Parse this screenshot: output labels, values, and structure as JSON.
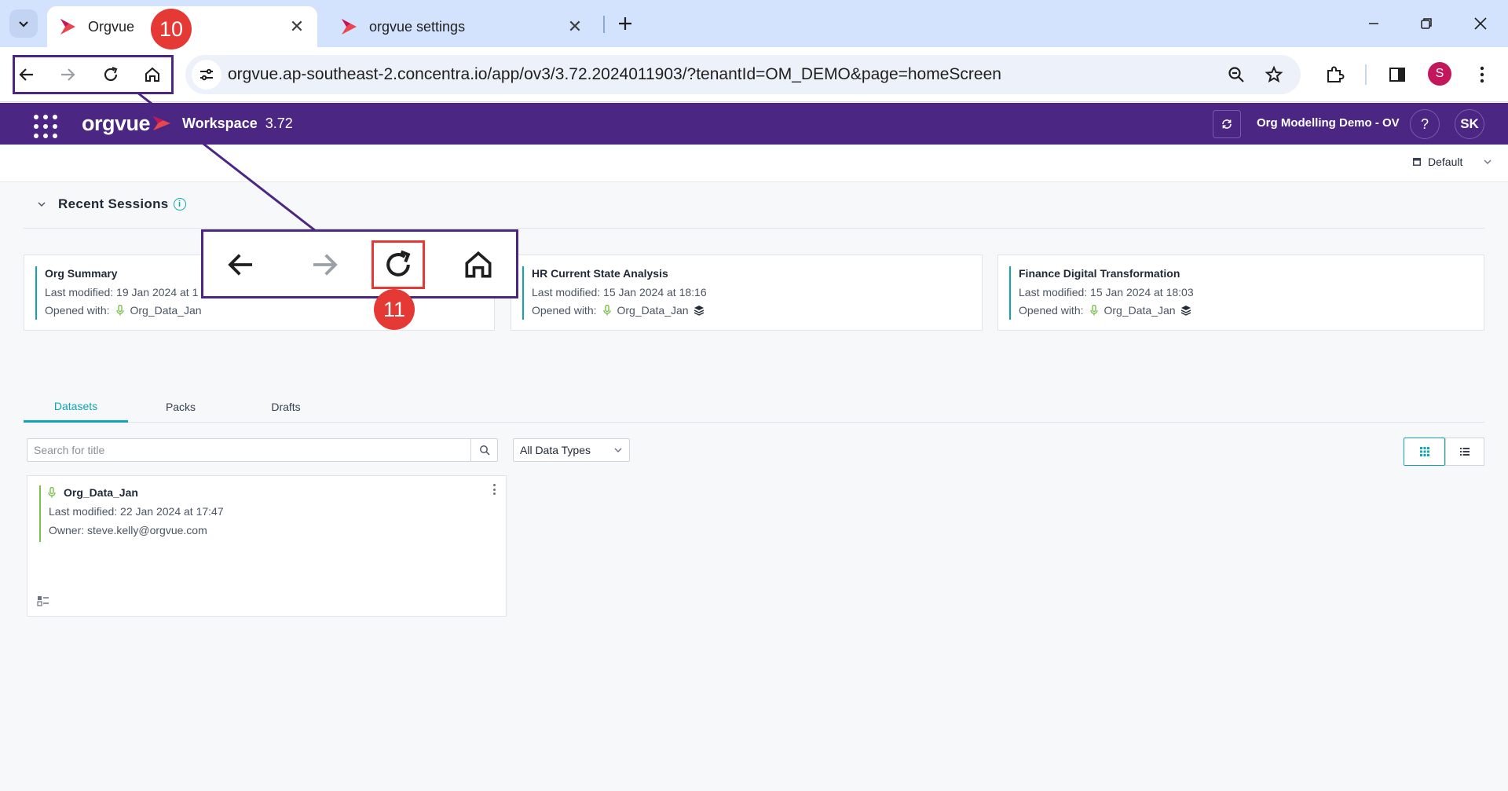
{
  "browser": {
    "tabs": [
      {
        "title": "Orgvue",
        "active": true
      },
      {
        "title": "orgvue settings",
        "active": false
      }
    ],
    "url": "orgvue.ap-southeast-2.concentra.io/app/ov3/3.72.2024011903/?tenantId=OM_DEMO&page=homeScreen",
    "profile_initial": "S",
    "icons": [
      "tab-search-icon",
      "back-arrow-icon",
      "forward-arrow-icon",
      "reload-icon",
      "home-icon",
      "site-settings-icon",
      "zoom-icon",
      "bookmark-star-icon",
      "extensions-icon",
      "side-panel-icon",
      "kebab-menu-icon"
    ]
  },
  "app": {
    "logo": "orgvue",
    "workspace_label": "Workspace",
    "version": "3.72",
    "tenant": "Org Modelling Demo - OV",
    "help_label": "?",
    "user_initials": "SK",
    "view_selector": "Default",
    "brand_color": "#4b2683",
    "accent_color": "#10a5b3"
  },
  "recent_sessions": {
    "title": "Recent Sessions",
    "info_label": "i",
    "cards": [
      {
        "title": "Org Summary",
        "modified": "Last modified: 19 Jan 2024 at 1",
        "opened_label": "Opened with:",
        "dataset": "Org_Data_Jan"
      },
      {
        "title": "HR Current State Analysis",
        "modified": "Last modified: 15 Jan 2024 at 18:16",
        "opened_label": "Opened with:",
        "dataset": "Org_Data_Jan"
      },
      {
        "title": "Finance Digital Transformation",
        "modified": "Last modified: 15 Jan 2024 at 18:03",
        "opened_label": "Opened with:",
        "dataset": "Org_Data_Jan"
      }
    ]
  },
  "library": {
    "tabs": [
      "Datasets",
      "Packs",
      "Drafts"
    ],
    "active_tab": "Datasets",
    "search_placeholder": "Search for title",
    "data_type_filter": "All Data Types",
    "datasets": [
      {
        "name": "Org_Data_Jan",
        "modified": "Last modified: 22 Jan 2024 at 17:47",
        "owner": "Owner: steve.kelly@orgvue.com"
      }
    ]
  },
  "annotations": {
    "step_a": "10",
    "step_b": "11"
  }
}
